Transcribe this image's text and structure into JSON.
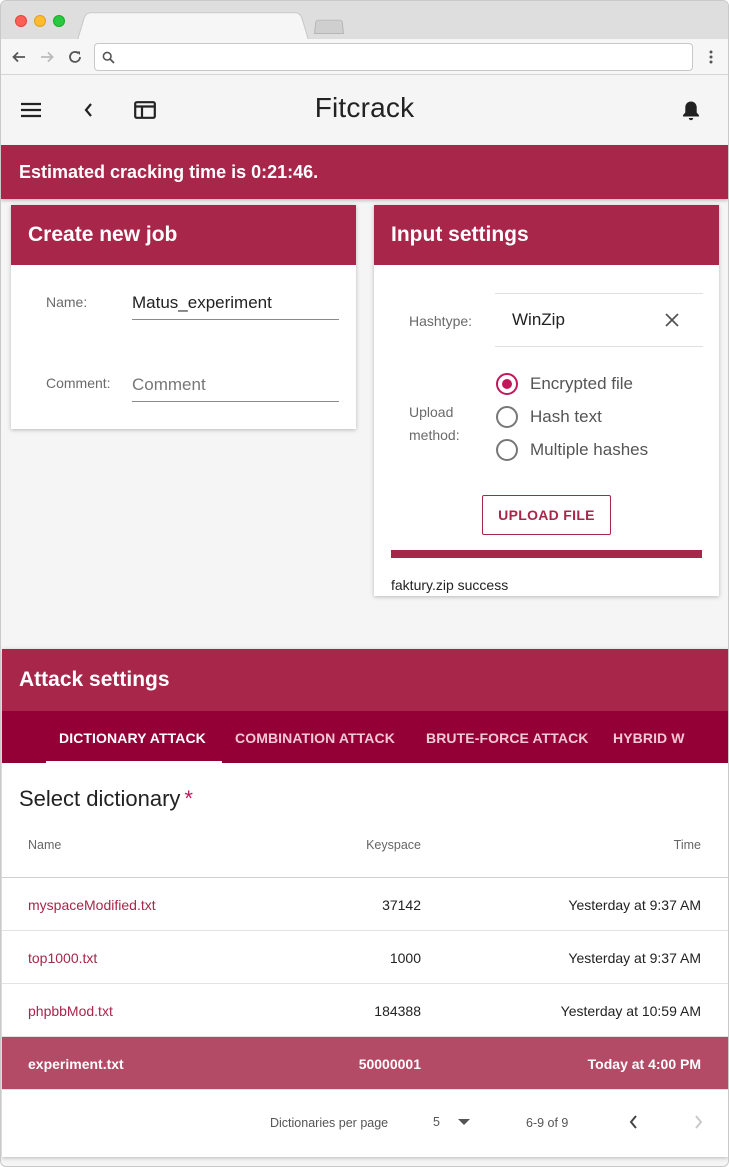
{
  "app": {
    "title": "Fitcrack"
  },
  "browser": {
    "url": ""
  },
  "banner": {
    "text": "Estimated cracking time is 0:21:46."
  },
  "create_job": {
    "title": "Create new job",
    "name_label": "Name:",
    "name_value": "Matus_experiment",
    "comment_label": "Comment:",
    "comment_placeholder": "Comment"
  },
  "input_settings": {
    "title": "Input settings",
    "hashtype_label": "Hashtype:",
    "hashtype_value": "WinZip",
    "upload_label_line1": "Upload",
    "upload_label_line2": "method:",
    "upload_options": [
      "Encrypted file",
      "Hash text",
      "Multiple hashes"
    ],
    "selected_option": "Encrypted file",
    "upload_button": "UPLOAD FILE",
    "upload_progress": 1.0,
    "upload_status": "faktury.zip success"
  },
  "attack": {
    "title": "Attack settings",
    "tabs": [
      "DICTIONARY ATTACK",
      "COMBINATION ATTACK",
      "BRUTE-FORCE ATTACK",
      "HYBRID W"
    ],
    "active_tab": "DICTIONARY ATTACK",
    "dictionary_heading": "Select dictionary",
    "required_mark": "*",
    "columns": [
      "Name",
      "Keyspace",
      "Time"
    ],
    "rows": [
      {
        "name": "myspaceModified.txt",
        "keyspace": "37142",
        "time": "Yesterday at 9:37 AM",
        "selected": false
      },
      {
        "name": "top1000.txt",
        "keyspace": "1000",
        "time": "Yesterday at 9:37 AM",
        "selected": false
      },
      {
        "name": "phpbbMod.txt",
        "keyspace": "184388",
        "time": "Yesterday at 10:59 AM",
        "selected": false
      },
      {
        "name": "experiment.txt",
        "keyspace": "50000001",
        "time": "Today at 4:00 PM",
        "selected": true
      }
    ],
    "pagination": {
      "per_page_label": "Dictionaries per page",
      "per_page_value": "5",
      "range_text": "6-9 of 9"
    }
  },
  "colors": {
    "brand": "#a8264a",
    "tab_bar": "#940035",
    "selected_row": "#b34a66",
    "accent": "#c2185b"
  }
}
